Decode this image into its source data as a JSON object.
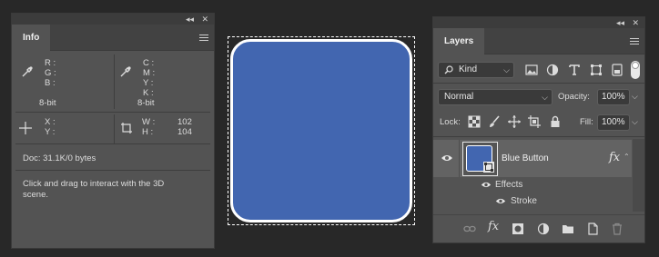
{
  "info_panel": {
    "tab": "Info",
    "rgb_labels": [
      "R :",
      "G :",
      "B :"
    ],
    "cmyk_labels": [
      "C :",
      "M :",
      "Y :",
      "K :"
    ],
    "bit_depth_left": "8-bit",
    "bit_depth_right": "8-bit",
    "xy_labels": [
      "X :",
      "Y :"
    ],
    "w_label": "W :",
    "h_label": "H :",
    "w_value": "102",
    "h_value": "104",
    "doc_info": "Doc: 31.1K/0 bytes",
    "hint": "Click and drag to interact with the 3D scene."
  },
  "layers_panel": {
    "tab": "Layers",
    "filter_kind": "Kind",
    "blend_mode": "Normal",
    "opacity_label": "Opacity:",
    "opacity_value": "100%",
    "lock_label": "Lock:",
    "fill_label": "Fill:",
    "fill_value": "100%",
    "layer_name": "Blue Button",
    "fx_badge": "fx",
    "effects_label": "Effects",
    "stroke_label": "Stroke"
  },
  "canvas": {
    "shape_fill": "#4266b0",
    "stroke_color": "#ffffff"
  }
}
